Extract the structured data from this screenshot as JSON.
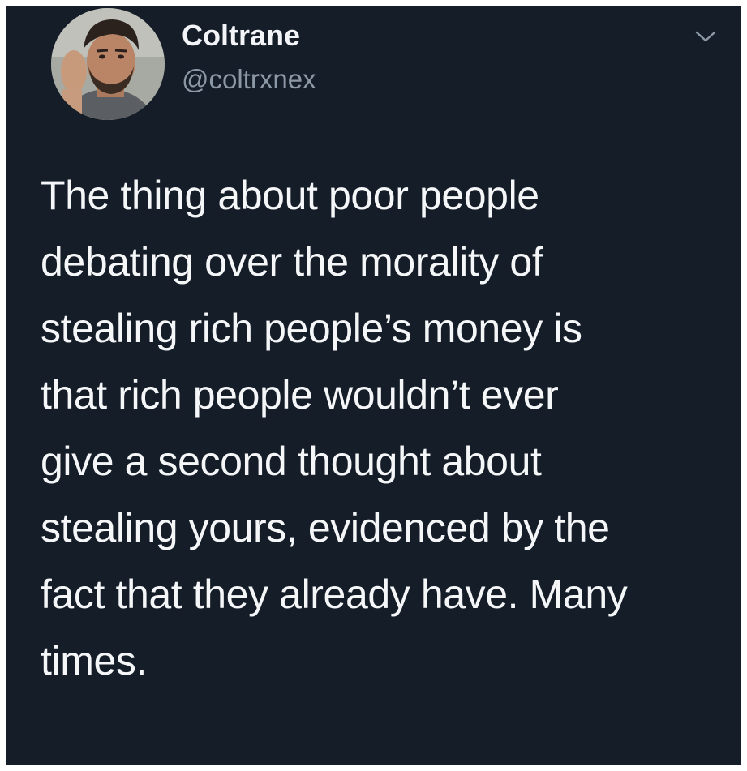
{
  "tweet": {
    "author": {
      "display_name": "Coltrane",
      "handle": "@coltrxnex",
      "avatar": "profile-photo"
    },
    "menu_icon": "chevron-down-icon",
    "text_lines": [
      "The thing about poor people",
      "debating over the morality of",
      "stealing rich people’s money is",
      "that rich people wouldn’t ever",
      "give a second thought about",
      "stealing yours, evidenced by the",
      "fact that they already have. Many",
      "times."
    ]
  },
  "colors": {
    "background": "#151d28",
    "text_primary": "#f4f6f8",
    "text_secondary": "#8c98a6"
  }
}
